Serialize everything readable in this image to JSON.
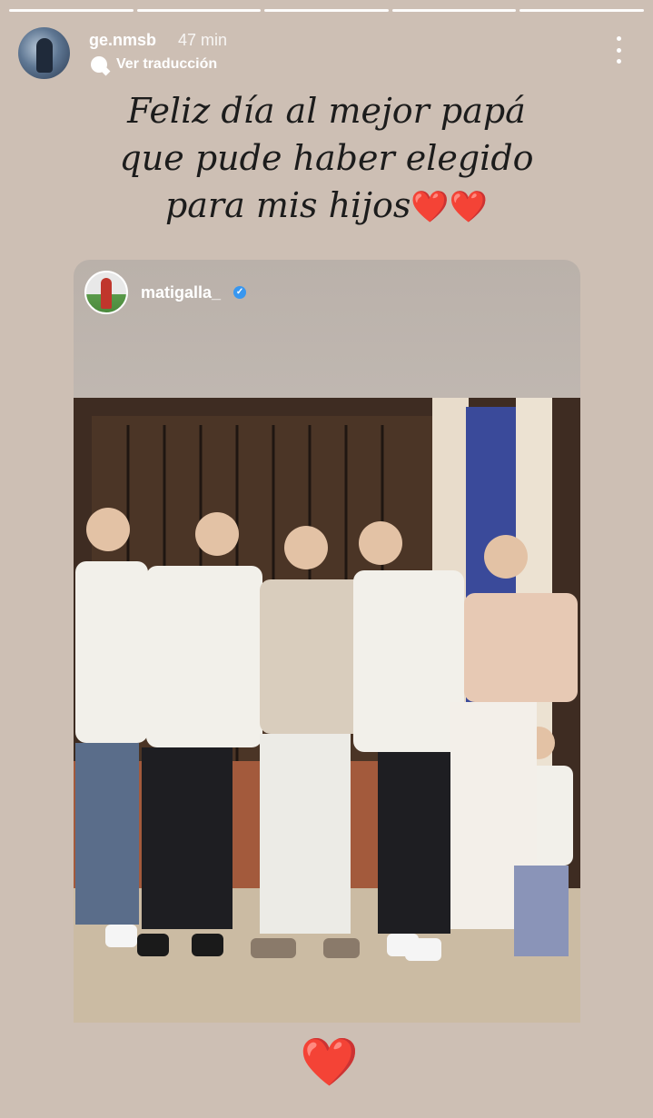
{
  "story": {
    "username": "ge.nmsb",
    "time": "47 min",
    "translate_label": "Ver traducción",
    "caption": "Feliz día al mejor papá que pude haber elegido para mis hijos",
    "caption_emoji": "❤️❤️",
    "progress_segments": 5,
    "active_segment": 5
  },
  "shared_post": {
    "username": "matigalla_",
    "verified": true
  },
  "reaction_emoji": "❤️",
  "icons": {
    "more": "more-vertical-icon",
    "translate": "translate-bubble-icon",
    "verified": "verified-badge-icon"
  },
  "colors": {
    "background": "#cdbfb4",
    "heart": "#e0201c",
    "verified": "#3897f0"
  }
}
